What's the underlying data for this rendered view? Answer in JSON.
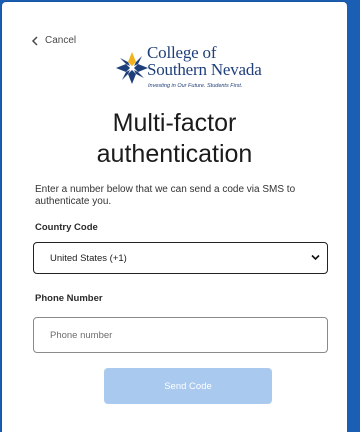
{
  "nav": {
    "cancel_label": "Cancel"
  },
  "logo": {
    "line1": "College of",
    "line2": "Southern Nevada",
    "tagline": "Investing in Our Future. Students First."
  },
  "page": {
    "title_line1": "Multi-factor",
    "title_line2": "authentication",
    "description": "Enter a number below that we can send a code via SMS to authenticate you."
  },
  "form": {
    "country_code_label": "Country Code",
    "country_code_value": "United States (+1)",
    "phone_label": "Phone Number",
    "phone_placeholder": "Phone number",
    "submit_label": "Send Code"
  },
  "colors": {
    "background_blue": "#1a5fb4",
    "brand_navy": "#1f3f7a",
    "brand_gold": "#f2b21c",
    "disabled_button": "#a9c9ee"
  }
}
